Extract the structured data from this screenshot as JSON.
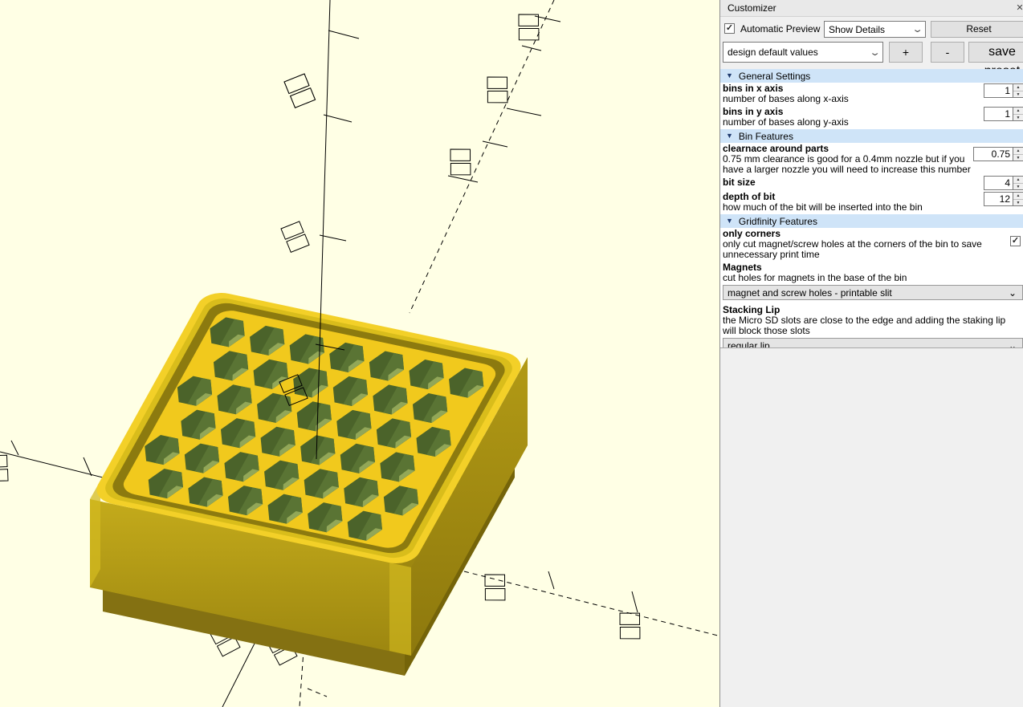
{
  "customizer": {
    "title": "Customizer",
    "icons": {
      "close": "✕",
      "check": "✓",
      "chevron": "⌄",
      "spin_up": "▲",
      "spin_down": "▼",
      "collapse": "▼"
    },
    "toolbar": {
      "automatic_preview_label": "Automatic Preview",
      "automatic_preview_checked": true,
      "detail_select_value": "Show Details",
      "reset_button": "Reset"
    },
    "preset_row": {
      "preset_select_value": "design default values",
      "add_button": "+",
      "remove_button": "-",
      "save_button": "save preset"
    },
    "sections": [
      {
        "title": "General Settings",
        "params": [
          {
            "name": "bins in x axis",
            "desc": "number of bases along x-axis",
            "type": "spin",
            "value": "1"
          },
          {
            "name": "bins in y axis",
            "desc": "number of bases along y-axis",
            "type": "spin",
            "value": "1"
          }
        ]
      },
      {
        "title": "Bin Features",
        "params": [
          {
            "name": "clearnace around parts",
            "desc": "0.75 mm clearance is good for a 0.4mm nozzle but if you have a larger nozzle you will need to increase this number",
            "type": "spin",
            "value": "0.75"
          },
          {
            "name": "bit size",
            "desc": "",
            "type": "spin",
            "value": "4"
          },
          {
            "name": "depth of bit",
            "desc": "how much of the bit will be inserted into the bin",
            "type": "spin",
            "value": "12"
          }
        ]
      },
      {
        "title": "Gridfinity Features",
        "params": [
          {
            "name": "only corners",
            "desc": "only cut magnet/screw holes at the corners of the bin to save unnecessary print time",
            "type": "checkbox",
            "checked": true,
            "check_glyph": "✓"
          },
          {
            "name": "Magnets",
            "desc": "cut holes for magnets in the base of the bin",
            "type": "select",
            "value": "magnet and screw holes - printable slit"
          },
          {
            "name": "Stacking Lip",
            "desc": "the Micro SD slots are close to the edge and adding the staking lip will block those slots",
            "type": "select",
            "value": "regular lip"
          }
        ]
      }
    ]
  },
  "viewport": {
    "background": "#ffffe5",
    "axis_color": "#000000",
    "bin": {
      "top_rim": "#f3d028",
      "band": "#d9bd1b",
      "groove": "#8c7a0f",
      "floor": "#f1c91d",
      "wall_left_top": "#c4ab1b",
      "wall_left_bottom": "#9c8610",
      "wall_right_top": "#b29a15",
      "wall_right_bottom": "#8d780d",
      "wall_bottom": "#9d8710",
      "base_left": "#847112",
      "base_right": "#756409",
      "base_bottom": "#6b5d0e",
      "corner_highlight": "#d3ba20",
      "hex_dark": "#4b632a",
      "hex_mid": "#5a7434",
      "hex_light": "#92a758",
      "hex_rows": [
        7,
        6,
        7,
        6,
        7,
        6
      ]
    }
  }
}
